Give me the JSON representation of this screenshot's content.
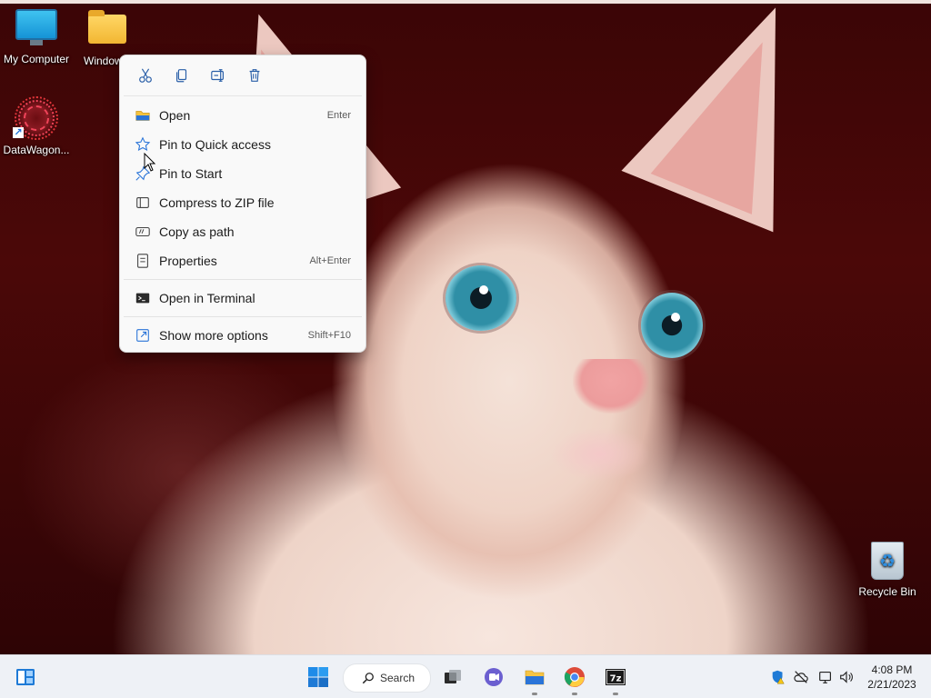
{
  "desktop": {
    "icons": [
      {
        "label": "My Computer"
      },
      {
        "label": "Window"
      },
      {
        "label": "DataWagon..."
      },
      {
        "label": "Recycle Bin"
      }
    ]
  },
  "context_menu": {
    "toolbar": [
      {
        "icon": "cut-icon"
      },
      {
        "icon": "copy-icon"
      },
      {
        "icon": "rename-icon"
      },
      {
        "icon": "delete-icon"
      }
    ],
    "items": [
      {
        "label": "Open",
        "accel": "Enter",
        "icon": "folder-open-icon"
      },
      {
        "label": "Pin to Quick access",
        "accel": "",
        "icon": "star-icon"
      },
      {
        "label": "Pin to Start",
        "accel": "",
        "icon": "pin-icon"
      },
      {
        "label": "Compress to ZIP file",
        "accel": "",
        "icon": "zip-icon"
      },
      {
        "label": "Copy as path",
        "accel": "",
        "icon": "copy-path-icon"
      },
      {
        "label": "Properties",
        "accel": "Alt+Enter",
        "icon": "properties-icon"
      },
      {
        "label": "Open in Terminal",
        "accel": "",
        "icon": "terminal-icon"
      },
      {
        "label": "Show more options",
        "accel": "Shift+F10",
        "icon": "more-options-icon"
      }
    ]
  },
  "taskbar": {
    "search_label": "Search",
    "clock_time": "4:08 PM",
    "clock_date": "2/21/2023",
    "apps": [
      {
        "name": "start-button"
      },
      {
        "name": "search"
      },
      {
        "name": "task-view"
      },
      {
        "name": "teams"
      },
      {
        "name": "file-explorer"
      },
      {
        "name": "chrome"
      },
      {
        "name": "7zip"
      }
    ]
  },
  "colors": {
    "accent": "#0067c0",
    "menu_bg": "#f9f9f9",
    "taskbar_bg": "#eef1f6"
  }
}
